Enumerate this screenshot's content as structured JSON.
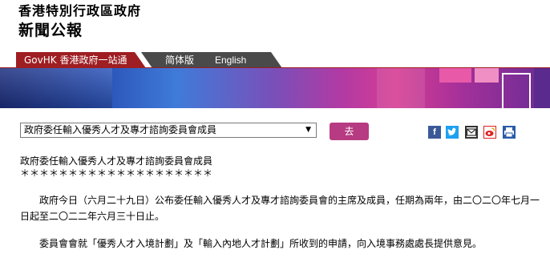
{
  "header": {
    "line1": "香港特別行政區政府",
    "line2": "新聞公報"
  },
  "nav": {
    "govhk": "GovHK 香港政府一站通",
    "simplified": "简体版",
    "english": "English"
  },
  "form": {
    "select_value": "政府委任輸入優秀人才及專才諮詢委員會成員",
    "go_label": "去"
  },
  "share_icons": [
    "facebook-icon",
    "twitter-icon",
    "mail-icon",
    "weibo-icon",
    "print-icon"
  ],
  "article": {
    "title": "政府委任輸入優秀人才及專才諮詢委員會成員",
    "stars": "＊＊＊＊＊＊＊＊＊＊＊＊＊＊＊＊＊＊＊＊",
    "para1": "政府今日（六月二十九日）公布委任輸入優秀人才及專才諮詢委員會的主席及成員，任期為兩年，由二〇二〇年七月一日起至二〇二二年六月三十日止。",
    "para2": "委員會會就「優秀人才入境計劃」及「輸入內地人才計劃」所收到的申請，向入境事務處處長提供意見。"
  },
  "colors": {
    "brand_red": "#9e1e22",
    "button_magenta": "#b73b82"
  }
}
